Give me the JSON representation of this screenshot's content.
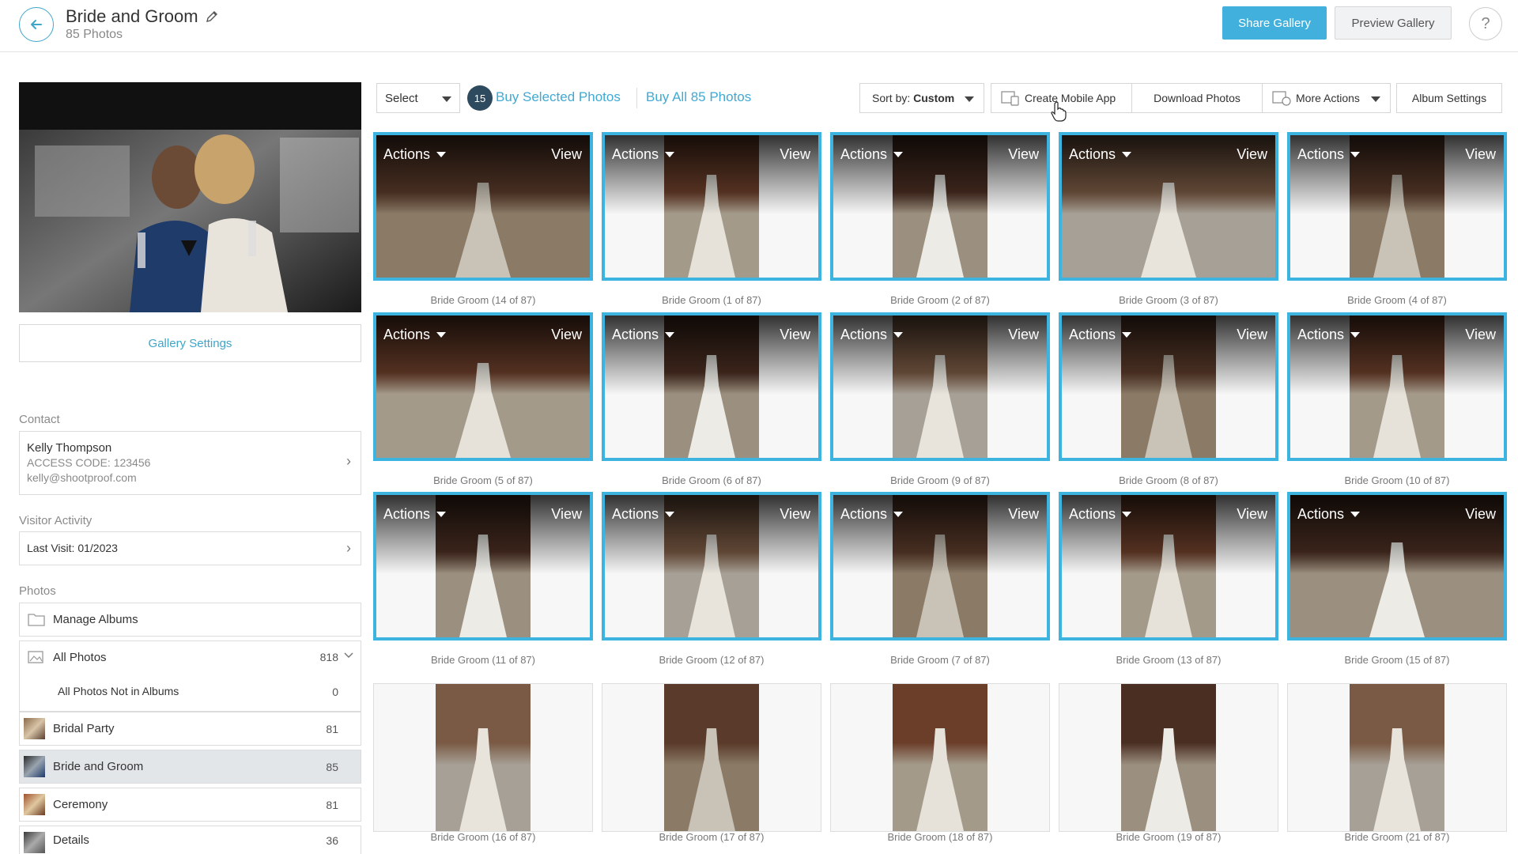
{
  "header": {
    "title": "Bride and Groom",
    "subtitle": "85 Photos",
    "share_label": "Share Gallery",
    "preview_label": "Preview Gallery",
    "help_label": "?"
  },
  "sidebar": {
    "gallery_settings_label": "Gallery Settings",
    "contact_heading": "Contact",
    "contact_name": "Kelly Thompson",
    "contact_access": "ACCESS CODE: 123456",
    "contact_email": "kelly@shootproof.com",
    "visitor_heading": "Visitor Activity",
    "visitor_last": "Last Visit: 01/2023",
    "photos_heading": "Photos",
    "manage_albums": "Manage Albums",
    "all_photos": {
      "label": "All Photos",
      "count": "818"
    },
    "not_in_albums": {
      "label": "All Photos Not in Albums",
      "count": "0"
    },
    "albums": [
      {
        "label": "Bridal Party",
        "count": "81"
      },
      {
        "label": "Bride and Groom",
        "count": "85"
      },
      {
        "label": "Ceremony",
        "count": "81"
      },
      {
        "label": "Details",
        "count": "36"
      }
    ]
  },
  "toolbar": {
    "select_label": "Select",
    "selected_count": "15",
    "buy_selected": "Buy Selected Photos",
    "buy_all": "Buy All 85 Photos",
    "sort_prefix": "Sort by:",
    "sort_value": "Custom",
    "create_app": "Create Mobile App",
    "download": "Download Photos",
    "more_actions": "More Actions",
    "album_settings": "Album Settings"
  },
  "tile_labels": {
    "actions": "Actions",
    "view": "View"
  },
  "photos": [
    {
      "caption": "Bride Groom (14 of 87)",
      "selected": true
    },
    {
      "caption": "Bride Groom (1 of 87)",
      "selected": true
    },
    {
      "caption": "Bride Groom (2 of 87)",
      "selected": true
    },
    {
      "caption": "Bride Groom (3 of 87)",
      "selected": true
    },
    {
      "caption": "Bride Groom (4 of 87)",
      "selected": true
    },
    {
      "caption": "Bride Groom (5 of 87)",
      "selected": true
    },
    {
      "caption": "Bride Groom (6 of 87)",
      "selected": true
    },
    {
      "caption": "Bride Groom (9 of 87)",
      "selected": true
    },
    {
      "caption": "Bride Groom (8 of 87)",
      "selected": true
    },
    {
      "caption": "Bride Groom (10 of 87)",
      "selected": true
    },
    {
      "caption": "Bride Groom (11 of 87)",
      "selected": true
    },
    {
      "caption": "Bride Groom (12 of 87)",
      "selected": true
    },
    {
      "caption": "Bride Groom (7 of 87)",
      "selected": true
    },
    {
      "caption": "Bride Groom (13 of 87)",
      "selected": true
    },
    {
      "caption": "Bride Groom (15 of 87)",
      "selected": true
    },
    {
      "caption": "Bride Groom (16 of 87)",
      "selected": false
    },
    {
      "caption": "Bride Groom (17 of 87)",
      "selected": false
    },
    {
      "caption": "Bride Groom (18 of 87)",
      "selected": false
    },
    {
      "caption": "Bride Groom (19 of 87)",
      "selected": false
    },
    {
      "caption": "Bride Groom (21 of 87)",
      "selected": false
    }
  ],
  "colors": {
    "accent": "#41b0dc",
    "selection_border": "#3db4e0",
    "count_badge": "#2d4a5e"
  }
}
